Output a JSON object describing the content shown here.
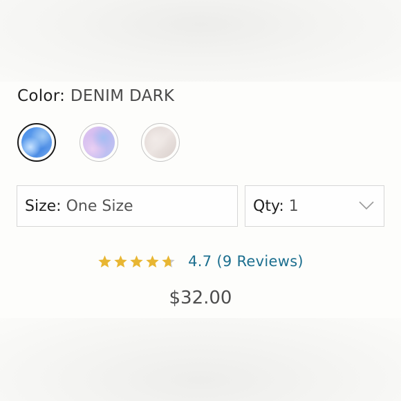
{
  "color": {
    "label": "Color:",
    "selected_value": "DENIM DARK",
    "swatches": [
      {
        "name": "denim-dark",
        "selected": true
      },
      {
        "name": "lavender",
        "selected": false
      },
      {
        "name": "cream",
        "selected": false
      }
    ]
  },
  "size": {
    "label": "Size:",
    "value": "One Size"
  },
  "quantity": {
    "label": "Qty:",
    "value": "1"
  },
  "rating": {
    "value": 4.7,
    "max": 5,
    "text": "4.7 (9 Reviews)"
  },
  "price": "$32.00",
  "colors": {
    "star": "#e8b632",
    "star_empty": "#c9c9c9",
    "link": "#1c6f8f",
    "price": "#4e4e4e"
  }
}
